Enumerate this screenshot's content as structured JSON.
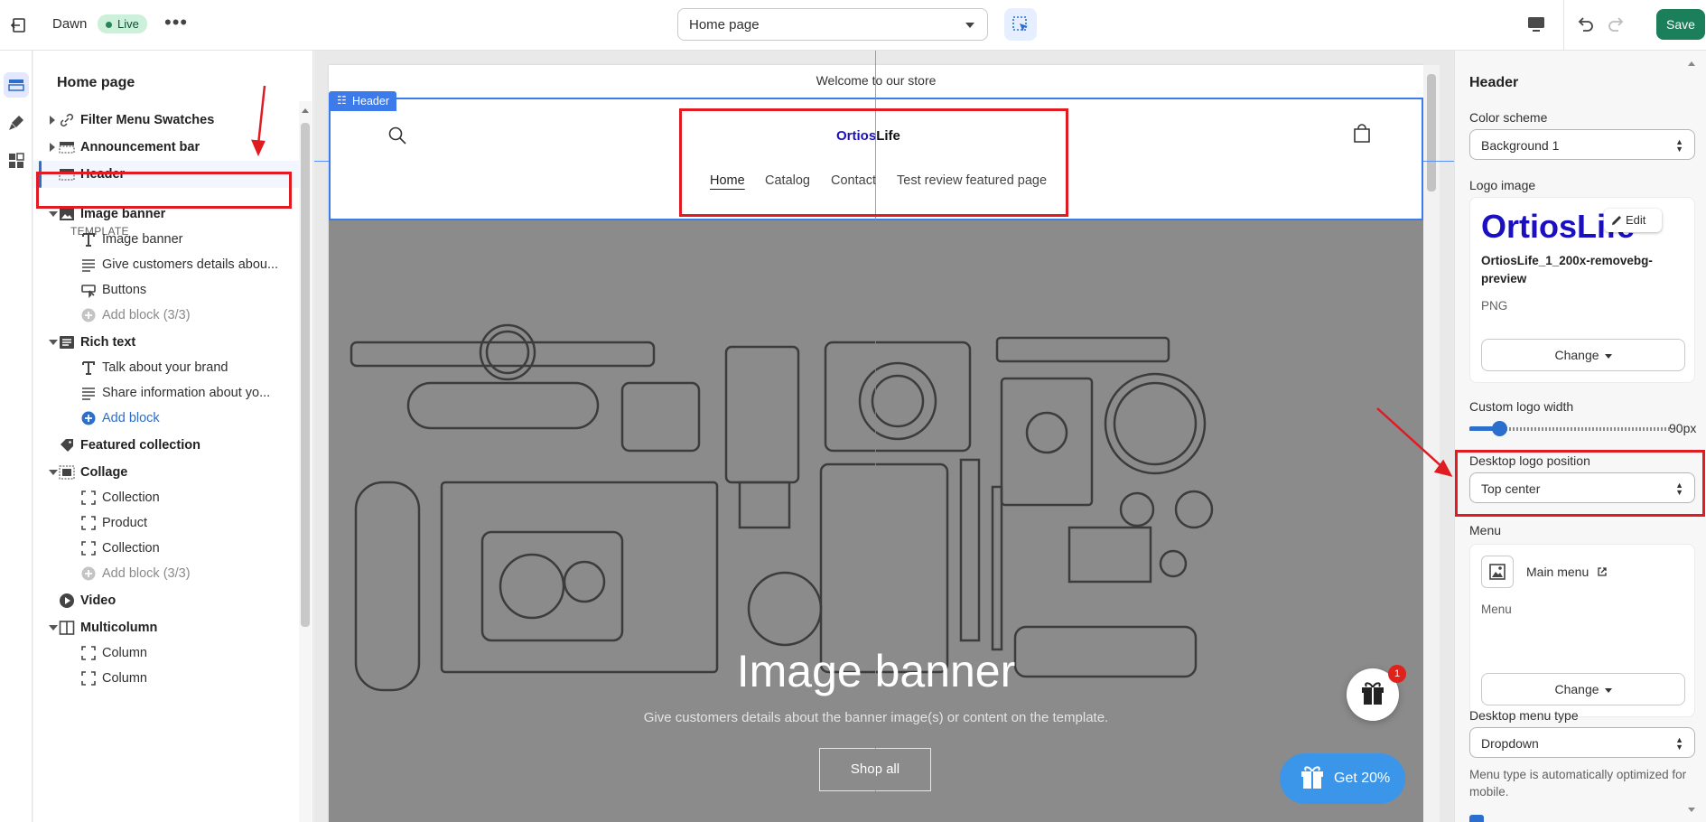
{
  "topbar": {
    "theme_name": "Dawn",
    "status_badge": "Live",
    "more_label": "•••",
    "page_selector": "Home page",
    "save_label": "Save"
  },
  "left_panel": {
    "title": "Home page",
    "template_label": "TEMPLATE",
    "items": [
      {
        "label": "Filter Menu Swatches",
        "icon": "link-icon"
      },
      {
        "label": "Announcement bar",
        "icon": "layout-icon"
      },
      {
        "label": "Header",
        "icon": "layout-icon"
      },
      {
        "label": "Image banner",
        "icon": "image-icon"
      },
      {
        "label": "Image banner",
        "icon": "text-icon"
      },
      {
        "label": "Give customers details abou...",
        "icon": "paragraph-icon"
      },
      {
        "label": "Buttons",
        "icon": "button-icon"
      },
      {
        "label": "Add block (3/3)",
        "icon": "plus-circle-icon"
      },
      {
        "label": "Rich text",
        "icon": "text-block-icon"
      },
      {
        "label": "Talk about your brand",
        "icon": "text-icon"
      },
      {
        "label": "Share information about yo...",
        "icon": "paragraph-icon"
      },
      {
        "label": "Add block",
        "icon": "plus-circle-icon"
      },
      {
        "label": "Featured collection",
        "icon": "tag-icon"
      },
      {
        "label": "Collage",
        "icon": "layout-icon"
      },
      {
        "label": "Collection",
        "icon": "frame-icon"
      },
      {
        "label": "Product",
        "icon": "frame-icon"
      },
      {
        "label": "Collection",
        "icon": "frame-icon"
      },
      {
        "label": "Add block (3/3)",
        "icon": "plus-circle-icon"
      },
      {
        "label": "Video",
        "icon": "play-icon"
      },
      {
        "label": "Multicolumn",
        "icon": "columns-icon"
      },
      {
        "label": "Column",
        "icon": "frame-icon"
      },
      {
        "label": "Column",
        "icon": "frame-icon"
      }
    ]
  },
  "preview": {
    "announcement": "Welcome to our store",
    "section_tag": "Header",
    "logo_part1": "Ortios",
    "logo_part2": "Life",
    "nav": [
      "Home",
      "Catalog",
      "Contact",
      "Test review featured page"
    ],
    "hero_title": "Image banner",
    "hero_subtitle": "Give customers details about the banner image(s) or content on the template.",
    "hero_button": "Shop all",
    "gift_badge": "1",
    "discount_button": "Get 20%"
  },
  "right_panel": {
    "title": "Header",
    "color_scheme_label": "Color scheme",
    "color_scheme_value": "Background 1",
    "logo_image_label": "Logo image",
    "logo_preview_text": "OrtiosLife",
    "edit_label": "Edit",
    "file_name": "OrtiosLife_1_200x-removebg-preview",
    "file_type": "PNG",
    "change_label": "Change",
    "logo_width_label": "Custom logo width",
    "logo_width_value": "90px",
    "logo_width_fraction": 0.15,
    "logo_position_label": "Desktop logo position",
    "logo_position_value": "Top center",
    "menu_label": "Menu",
    "menu_name": "Main menu",
    "menu_sub": "Menu",
    "menu_change_label": "Change",
    "menu_type_label": "Desktop menu type",
    "menu_type_value": "Dropdown",
    "menu_type_help": "Menu type is automatically optimized for mobile."
  },
  "colors": {
    "accent_blue": "#2c6ecb",
    "save_green": "#1a7f5a",
    "annotation_red": "#e11b22",
    "logo_blue": "#1a10c0"
  }
}
